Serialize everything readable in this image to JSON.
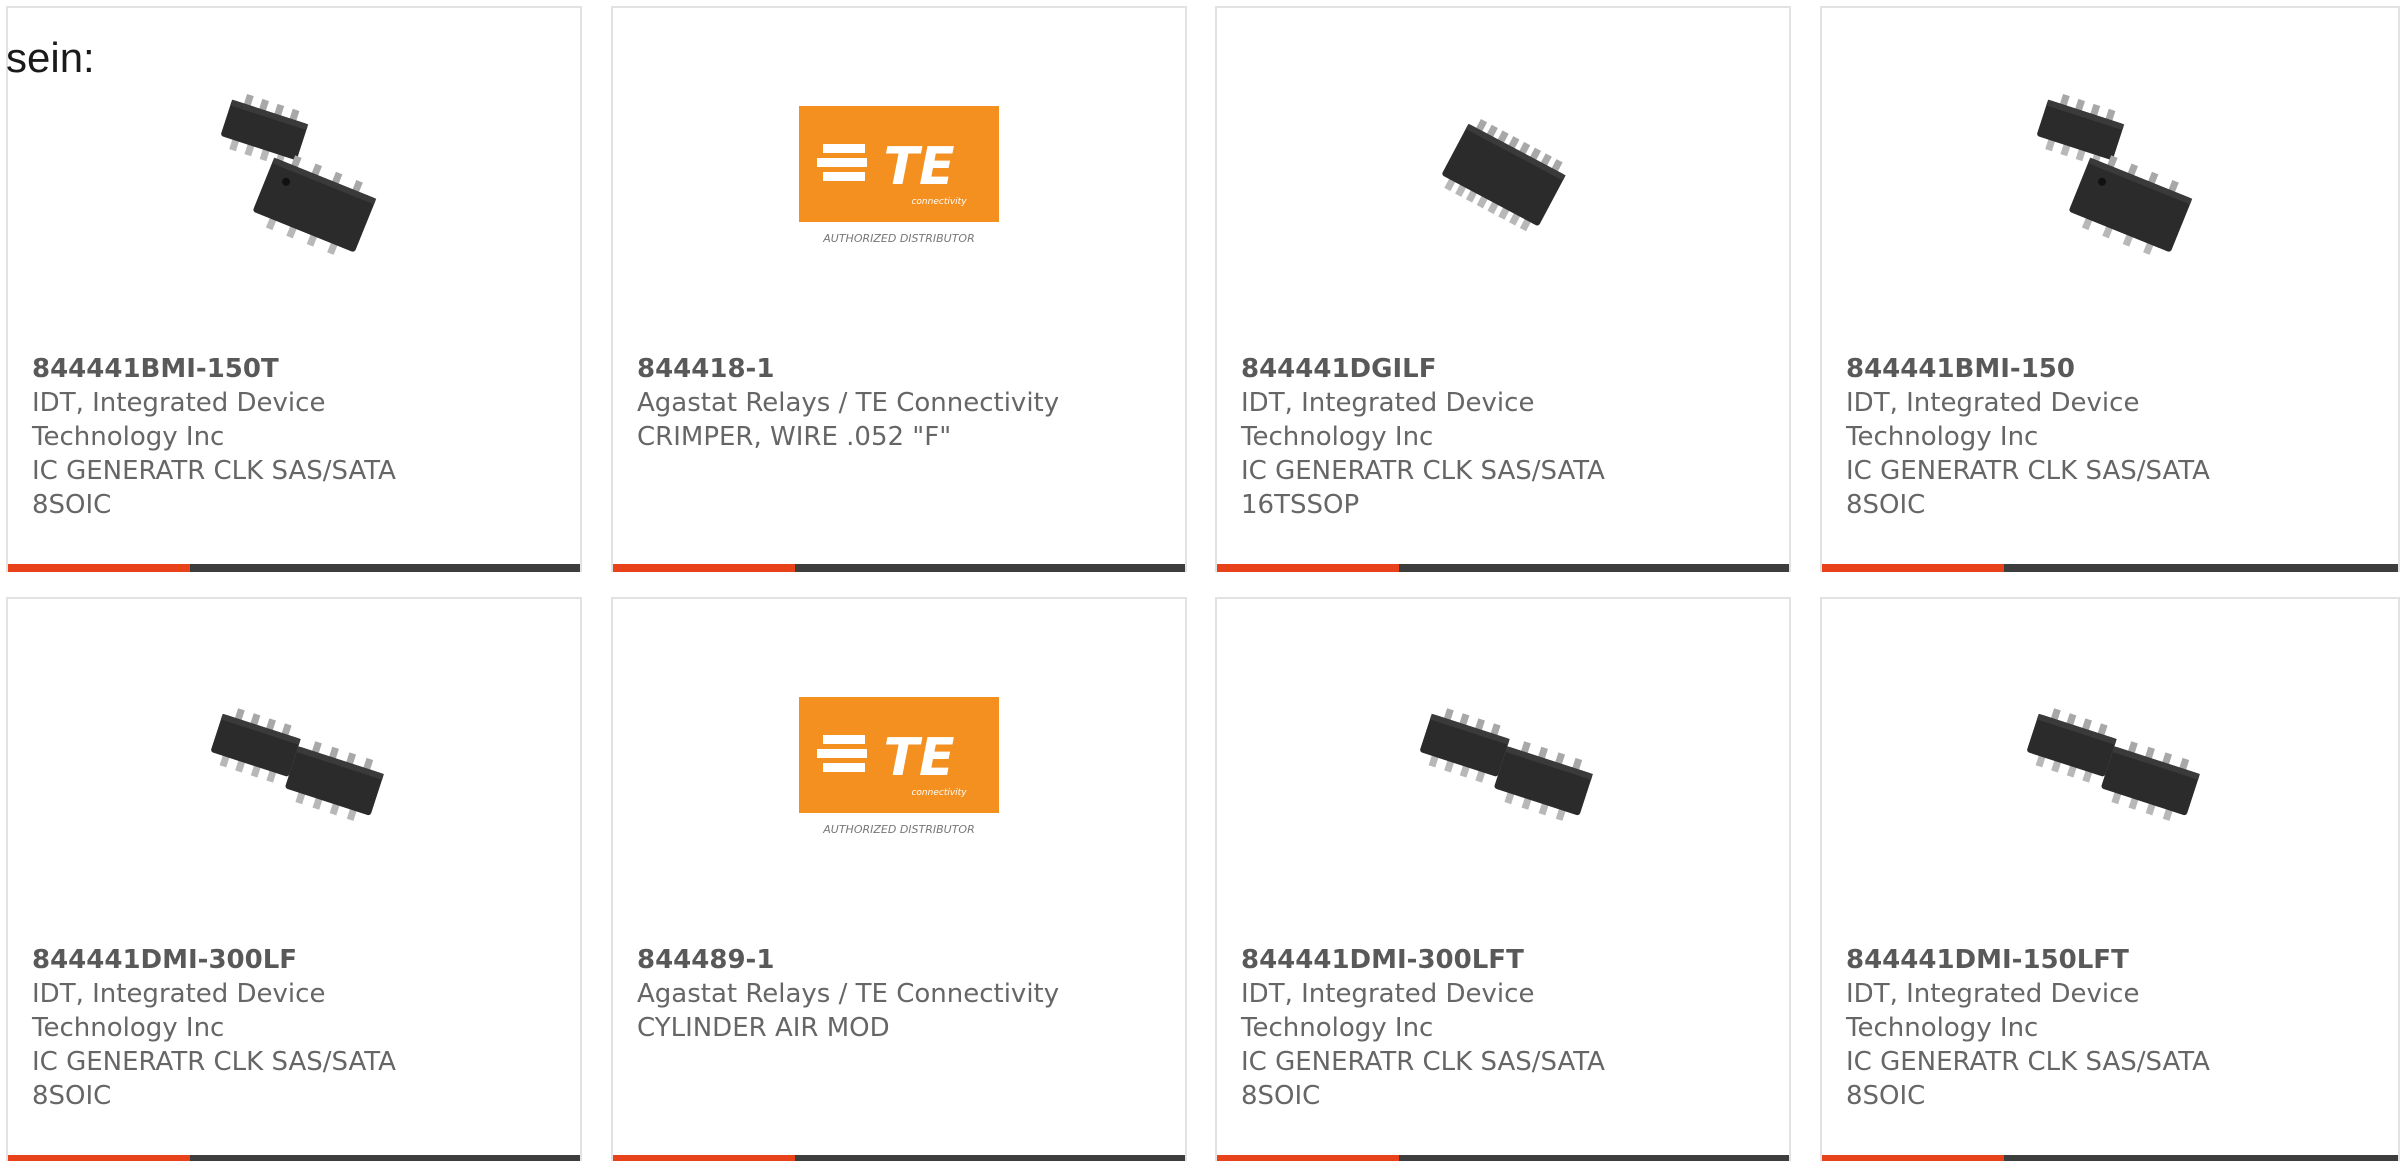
{
  "page_label": "sein:",
  "colors": {
    "accent": "#e8421a",
    "bar": "#3d3d3d",
    "te_orange": "#f39020",
    "text": "#666666"
  },
  "cards": [
    {
      "part_number": "844441BMI-150T",
      "manufacturer": "IDT, Integrated Device\nTechnology Inc",
      "description": "IC GENERATR CLK SAS/SATA\n8SOIC",
      "image": "soic8-chip-pair-icon"
    },
    {
      "part_number": "844418-1",
      "manufacturer": "Agastat Relays / TE Connectivity",
      "description": "CRIMPER, WIRE .052 \"F\"",
      "image": "te-connectivity-logo",
      "logo_text": "TE",
      "logo_sub": "connectivity",
      "logo_caption": "AUTHORIZED DISTRIBUTOR"
    },
    {
      "part_number": "844441DGILF",
      "manufacturer": "IDT, Integrated Device\nTechnology Inc",
      "description": "IC GENERATR CLK SAS/SATA\n16TSSOP",
      "image": "tssop16-chip-icon"
    },
    {
      "part_number": "844441BMI-150",
      "manufacturer": "IDT, Integrated Device\nTechnology Inc",
      "description": "IC GENERATR CLK SAS/SATA\n8SOIC",
      "image": "soic8-chip-pair-icon"
    },
    {
      "part_number": "844441DMI-300LF",
      "manufacturer": "IDT, Integrated Device\nTechnology Inc",
      "description": "IC GENERATR CLK SAS/SATA\n8SOIC",
      "image": "soic8-chip-pair-flat-icon"
    },
    {
      "part_number": "844489-1",
      "manufacturer": "Agastat Relays / TE Connectivity",
      "description": "CYLINDER AIR MOD",
      "image": "te-connectivity-logo",
      "logo_text": "TE",
      "logo_sub": "connectivity",
      "logo_caption": "AUTHORIZED DISTRIBUTOR"
    },
    {
      "part_number": "844441DMI-300LFT",
      "manufacturer": "IDT, Integrated Device\nTechnology Inc",
      "description": "IC GENERATR CLK SAS/SATA\n8SOIC",
      "image": "soic8-chip-pair-flat-icon"
    },
    {
      "part_number": "844441DMI-150LFT",
      "manufacturer": "IDT, Integrated Device\nTechnology Inc",
      "description": "IC GENERATR CLK SAS/SATA\n8SOIC",
      "image": "soic8-chip-pair-flat-icon"
    }
  ]
}
